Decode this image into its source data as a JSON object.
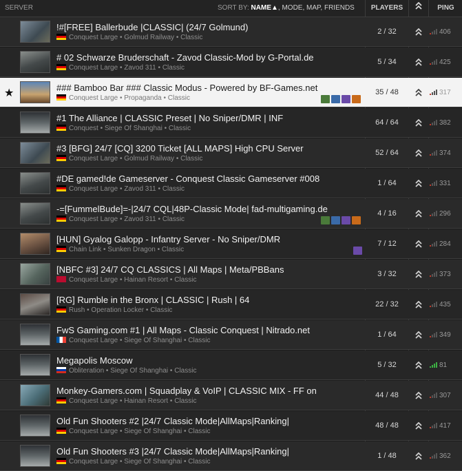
{
  "header": {
    "server_label": "SERVER",
    "sort_by_label": "SORT BY:",
    "sort_name": "NAME",
    "sort_arrow": "▲",
    "sort_other": ", MODE, MAP, FRIENDS",
    "players_label": "PLAYERS",
    "rank_icon": "rank-chevron-icon",
    "ping_label": "PING"
  },
  "servers": [
    {
      "name": "!#[FREE] Ballerbude |CLASSIC| (24/7 Golmund)",
      "mode": "Conquest Large",
      "map": "Golmud Railway",
      "preset": "Classic",
      "players": "2 / 32",
      "ping": "406",
      "flag": "de"
    },
    {
      "name": "# 02 Schwarze Bruderschaft - Zavod Classic-Mod by G-Portal.de",
      "mode": "Conquest Large",
      "map": "Zavod 311",
      "preset": "Classic",
      "players": "5 / 34",
      "ping": "425",
      "flag": "de"
    },
    {
      "name": "### Bamboo Bar ### Classic Modus - Powered by BF-Games.net",
      "mode": "Conquest Large",
      "map": "Propaganda",
      "preset": "Classic",
      "players": "35 / 48",
      "ping": "317",
      "flag": "de",
      "selected": true,
      "favorite_icon": "★"
    },
    {
      "name": "#1 The Alliance | CLASSIC Preset | No Sniper/DMR | INF",
      "mode": "Conquest",
      "map": "Siege Of Shanghai",
      "preset": "Classic",
      "players": "64 / 64",
      "ping": "382",
      "flag": "de"
    },
    {
      "name": "#3 [BFG] 24/7 [CQ] 3200 Ticket [ALL MAPS] High CPU Server",
      "mode": "Conquest Large",
      "map": "Golmud Railway",
      "preset": "Classic",
      "players": "52 / 64",
      "ping": "374",
      "flag": "de"
    },
    {
      "name": "#DE gamed!de Gameserver - Conquest Classic Gameserver #008",
      "mode": "Conquest Large",
      "map": "Zavod 311",
      "preset": "Classic",
      "players": "1 / 64",
      "ping": "331",
      "flag": "de"
    },
    {
      "name": "-=[FummelBude]=-|24/7 CQL|48P-Classic Mode| fad-multigaming.de",
      "mode": "Conquest Large",
      "map": "Zavod 311",
      "preset": "Classic",
      "players": "4 / 16",
      "ping": "296",
      "flag": "de"
    },
    {
      "name": "[HUN] Gyalog Galopp - Infantry Server - No Sniper/DMR",
      "mode": "Chain Link",
      "map": "Sunken Dragon",
      "preset": "Classic",
      "players": "7 / 12",
      "ping": "284",
      "flag": "de"
    },
    {
      "name": "[NBFC #3] 24/7 CQ CLASSICS | All Maps | Meta/PBBans",
      "mode": "Conquest Large",
      "map": "Hainan Resort",
      "preset": "Classic",
      "players": "3 / 32",
      "ping": "373",
      "flag": "no"
    },
    {
      "name": "[RG] Rumble in the Bronx | CLASSIC | Rush | 64",
      "mode": "Rush",
      "map": "Operation Locker",
      "preset": "Classic",
      "players": "22 / 32",
      "ping": "435",
      "flag": "de"
    },
    {
      "name": "FwS Gaming.com #1 | All Maps - Classic Conquest | Nitrado.net",
      "mode": "Conquest Large",
      "map": "Siege Of Shanghai",
      "preset": "Classic",
      "players": "1 / 64",
      "ping": "349",
      "flag": "fr"
    },
    {
      "name": "Megapolis  Moscow",
      "mode": "Obliteration",
      "map": "Siege Of Shanghai",
      "preset": "Classic",
      "players": "5 / 32",
      "ping": "81",
      "flag": "ru",
      "good_ping": true
    },
    {
      "name": "Monkey-Gamers.com | Squadplay & VoIP | CLASSIC MIX - FF on",
      "mode": "Conquest Large",
      "map": "Hainan Resort",
      "preset": "Classic",
      "players": "44 / 48",
      "ping": "307",
      "flag": "de"
    },
    {
      "name": "Old Fun Shooters #2 |24/7 Classic Mode|AllMaps|Ranking|",
      "mode": "Conquest Large",
      "map": "Siege Of Shanghai",
      "preset": "Classic",
      "players": "48 / 48",
      "ping": "417",
      "flag": "de"
    },
    {
      "name": "Old Fun Shooters #3 |24/7 Classic Mode|AllMaps|Ranking|",
      "mode": "Conquest Large",
      "map": "Siege Of Shanghai",
      "preset": "Classic",
      "players": "1 / 48",
      "ping": "362",
      "flag": "de"
    }
  ],
  "separator": " • ",
  "colors": {
    "accent_selected_bg": "#f3f3f3",
    "ping_bad": "#c0392b",
    "ping_good": "#3cb043",
    "background": "#1c1c1c"
  }
}
